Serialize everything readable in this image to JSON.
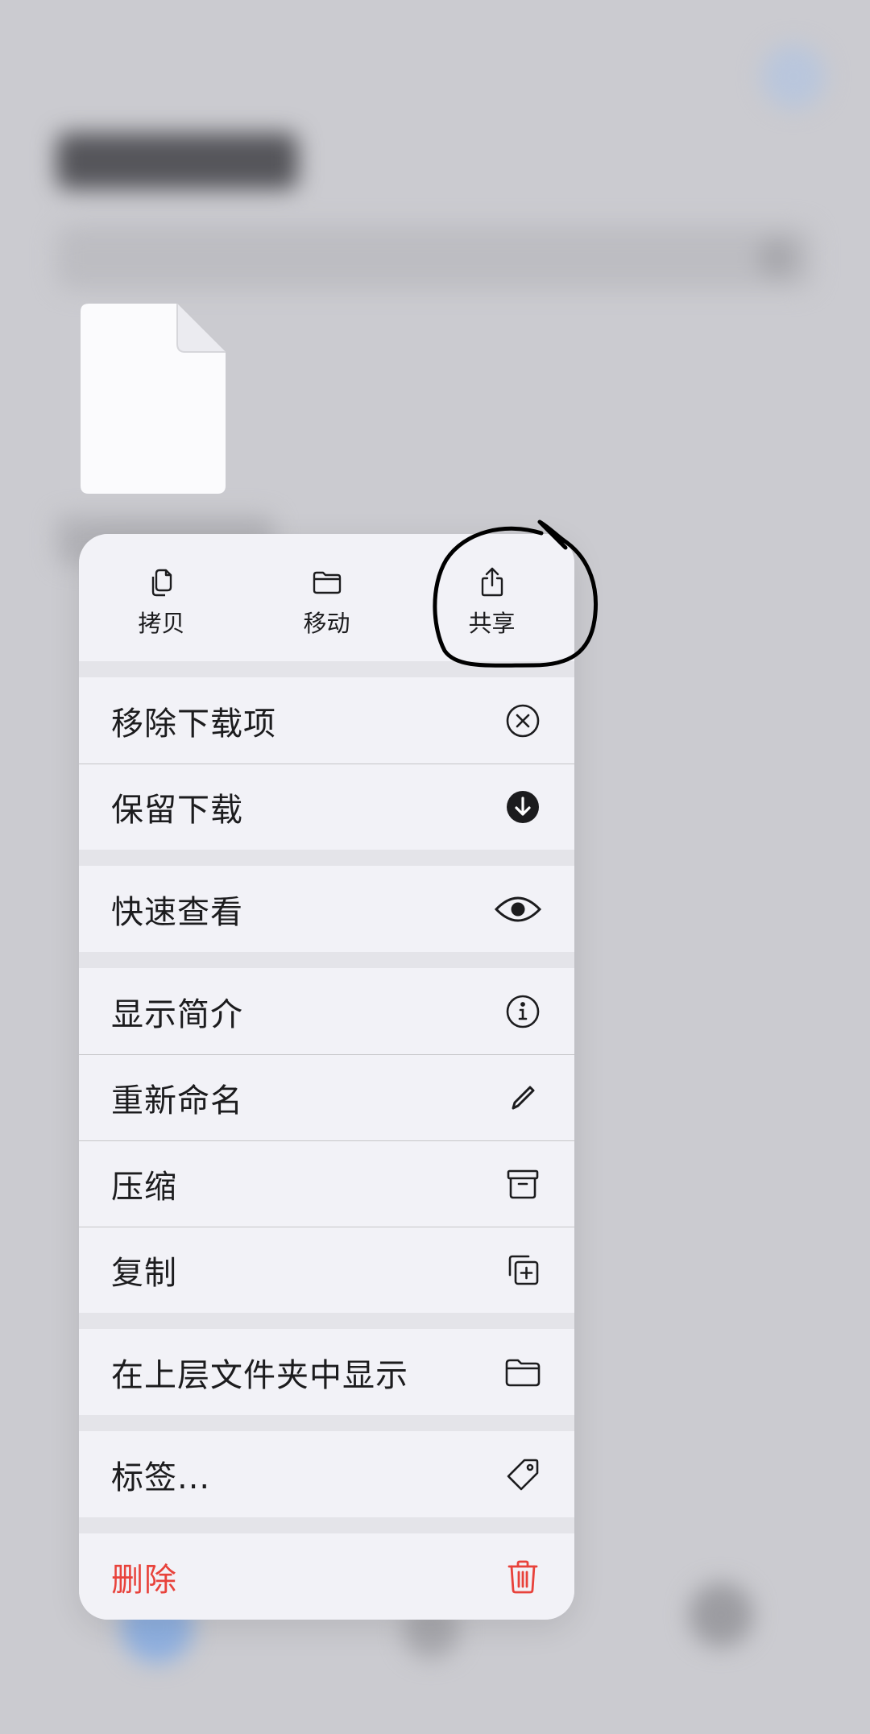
{
  "quick_actions": [
    {
      "label": "拷贝",
      "icon": "copy-docs-icon"
    },
    {
      "label": "移动",
      "icon": "folder-icon"
    },
    {
      "label": "共享",
      "icon": "share-icon"
    }
  ],
  "menu_groups": [
    [
      {
        "label": "移除下载项",
        "icon": "x-circle-icon"
      },
      {
        "label": "保留下载",
        "icon": "download-circle-icon"
      }
    ],
    [
      {
        "label": "快速查看",
        "icon": "eye-icon"
      }
    ],
    [
      {
        "label": "显示简介",
        "icon": "info-circle-icon"
      },
      {
        "label": "重新命名",
        "icon": "pencil-icon"
      },
      {
        "label": "压缩",
        "icon": "archive-box-icon"
      },
      {
        "label": "复制",
        "icon": "duplicate-icon"
      }
    ],
    [
      {
        "label": "在上层文件夹中显示",
        "icon": "folder-icon"
      }
    ],
    [
      {
        "label": "标签...",
        "icon": "tag-icon"
      }
    ],
    [
      {
        "label": "删除",
        "icon": "trash-icon"
      }
    ]
  ],
  "colors": {
    "destructive": "#e8423b",
    "menu_background": "#f2f2f7",
    "annotation_stroke": "#000000"
  }
}
